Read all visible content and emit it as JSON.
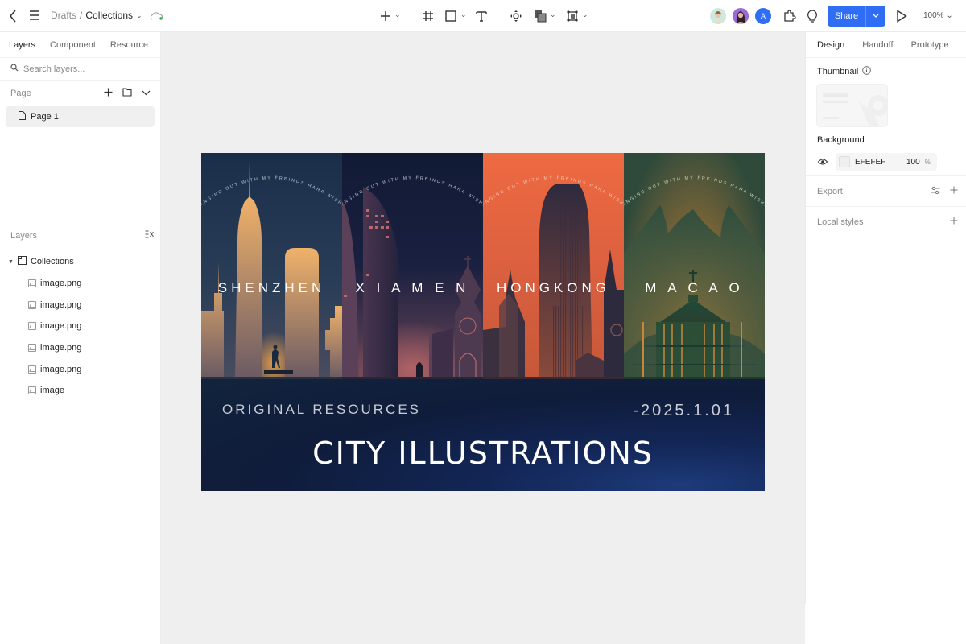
{
  "topbar": {
    "breadcrumb_root": "Drafts",
    "breadcrumb_sep": "/",
    "breadcrumb_current": "Collections",
    "share_label": "Share",
    "zoom_level": "100%",
    "collaborators": [
      {
        "name": "collaborator-1",
        "color": "#cfe9df"
      },
      {
        "name": "collaborator-2",
        "color": "#9b6ad6"
      },
      {
        "name": "collaborator-3",
        "initial": "A",
        "color": "#2f6df5"
      }
    ],
    "accent_color": "#2f6df5"
  },
  "left_panel": {
    "tabs": [
      {
        "label": "Layers",
        "active": true
      },
      {
        "label": "Component"
      },
      {
        "label": "Resource"
      }
    ],
    "search_placeholder": "Search layers...",
    "page_section_label": "Page",
    "pages": [
      {
        "label": "Page 1",
        "selected": true
      }
    ],
    "layers_section_label": "Layers",
    "layers": {
      "group": "Collections",
      "children": [
        "image.png",
        "image.png",
        "image.png",
        "image.png",
        "image.png",
        "image"
      ]
    }
  },
  "right_panel": {
    "tabs": [
      {
        "label": "Design",
        "active": true
      },
      {
        "label": "Handoff"
      },
      {
        "label": "Prototype"
      }
    ],
    "thumbnail_label": "Thumbnail",
    "background_label": "Background",
    "background_hex": "EFEFEF",
    "background_opacity": "100",
    "background_opacity_unit": "%",
    "export_label": "Export",
    "local_styles_label": "Local styles"
  },
  "canvas": {
    "background_color": "#efefef",
    "artwork": {
      "arc_text": "HANGING OUT WITH MY FREINDS HAHA WISHING",
      "cities": [
        {
          "name": "SHENZHEN",
          "sky_top": "#1a2e4a",
          "sky_bottom": "#3a4a63",
          "accent": "#e9a55b"
        },
        {
          "name": "X I A M E N",
          "sky_top": "#121c38",
          "sky_bottom": "#51384e",
          "accent": "#c0696a"
        },
        {
          "name": "HONGKONG",
          "sky_top": "#ee6a41",
          "sky_bottom": "#c8583a",
          "accent": "#3a2e3a"
        },
        {
          "name": "M A C A O",
          "sky_top": "#2f4a3a",
          "sky_bottom": "#a06b35",
          "accent": "#234a3a"
        }
      ],
      "subtitle": "ORIGINAL RESOURCES",
      "date": "-2025.1.01",
      "title": "CITY ILLUSTRATIONS"
    }
  }
}
